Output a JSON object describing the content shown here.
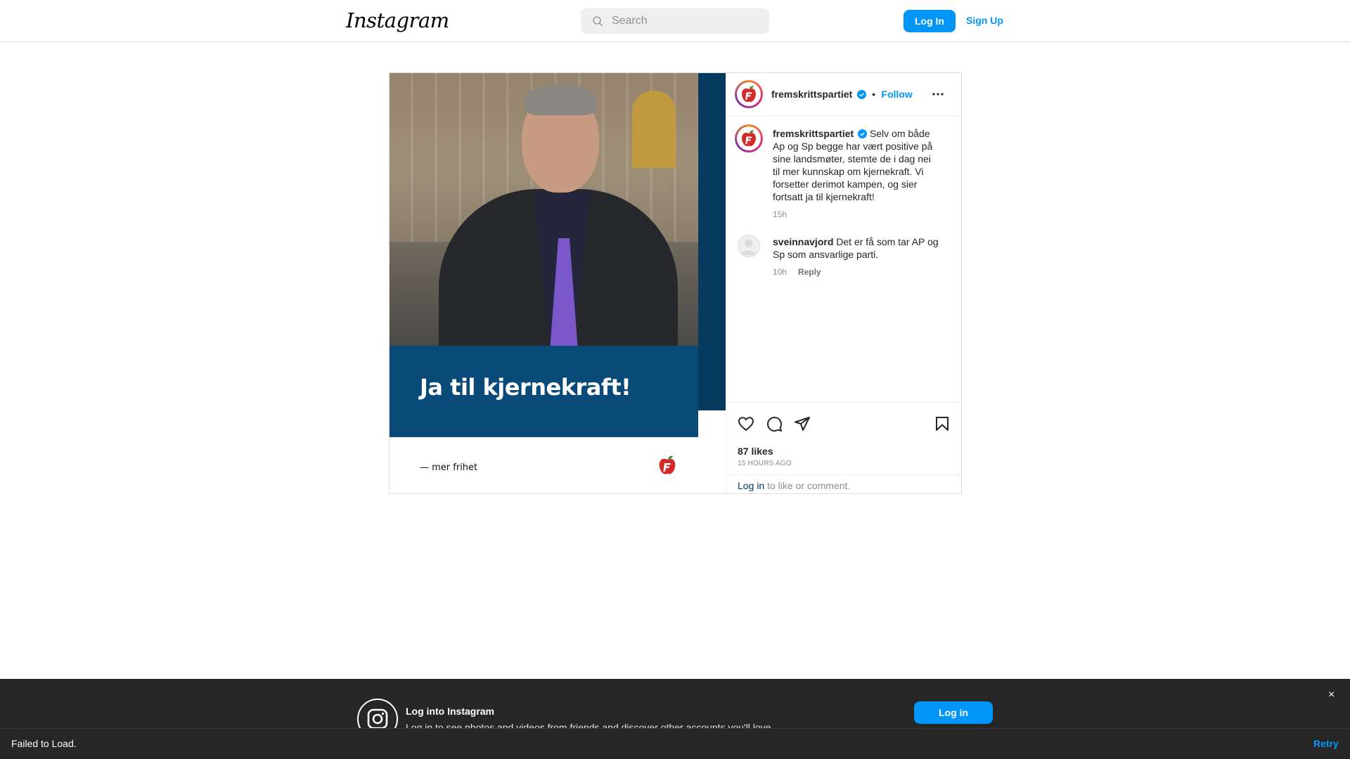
{
  "header": {
    "logo": "Instagram",
    "search_placeholder": "Search",
    "login_label": "Log In",
    "signup_label": "Sign Up"
  },
  "post": {
    "image_text": "Ja til kjernekraft!",
    "image_slogan": "— mer frihet",
    "author": {
      "username": "fremskrittspartiet",
      "verified": true,
      "follow_label": "Follow",
      "separator": "•"
    },
    "caption": {
      "username": "fremskrittspartiet",
      "text": "Selv om både Ap og Sp begge har vært positive på sine landsmøter, stemte de i dag nei til mer kunnskap om kjernekraft. Vi forsetter derimot kampen, og sier fortsatt ja til kjernekraft!",
      "time": "15h"
    },
    "comments": [
      {
        "username": "sveinnavjord",
        "text": "Det er få som tar AP og Sp som ansvarlige parti.",
        "time": "10h",
        "reply_label": "Reply"
      }
    ],
    "likes": "87 likes",
    "posted_ago": "15 HOURS AGO",
    "login_prompt": {
      "link": "Log in",
      "rest": " to like or comment."
    }
  },
  "login_banner": {
    "title": "Log into Instagram",
    "subtitle": "Log in to see photos and videos from friends and discover other accounts you'll love.",
    "button": "Log in",
    "close": "×"
  },
  "snackbar": {
    "message": "Failed to Load.",
    "action": "Retry"
  },
  "colors": {
    "accent": "#0095f6",
    "banner_blue": "#0a4a79",
    "dark_bar": "#262626"
  }
}
